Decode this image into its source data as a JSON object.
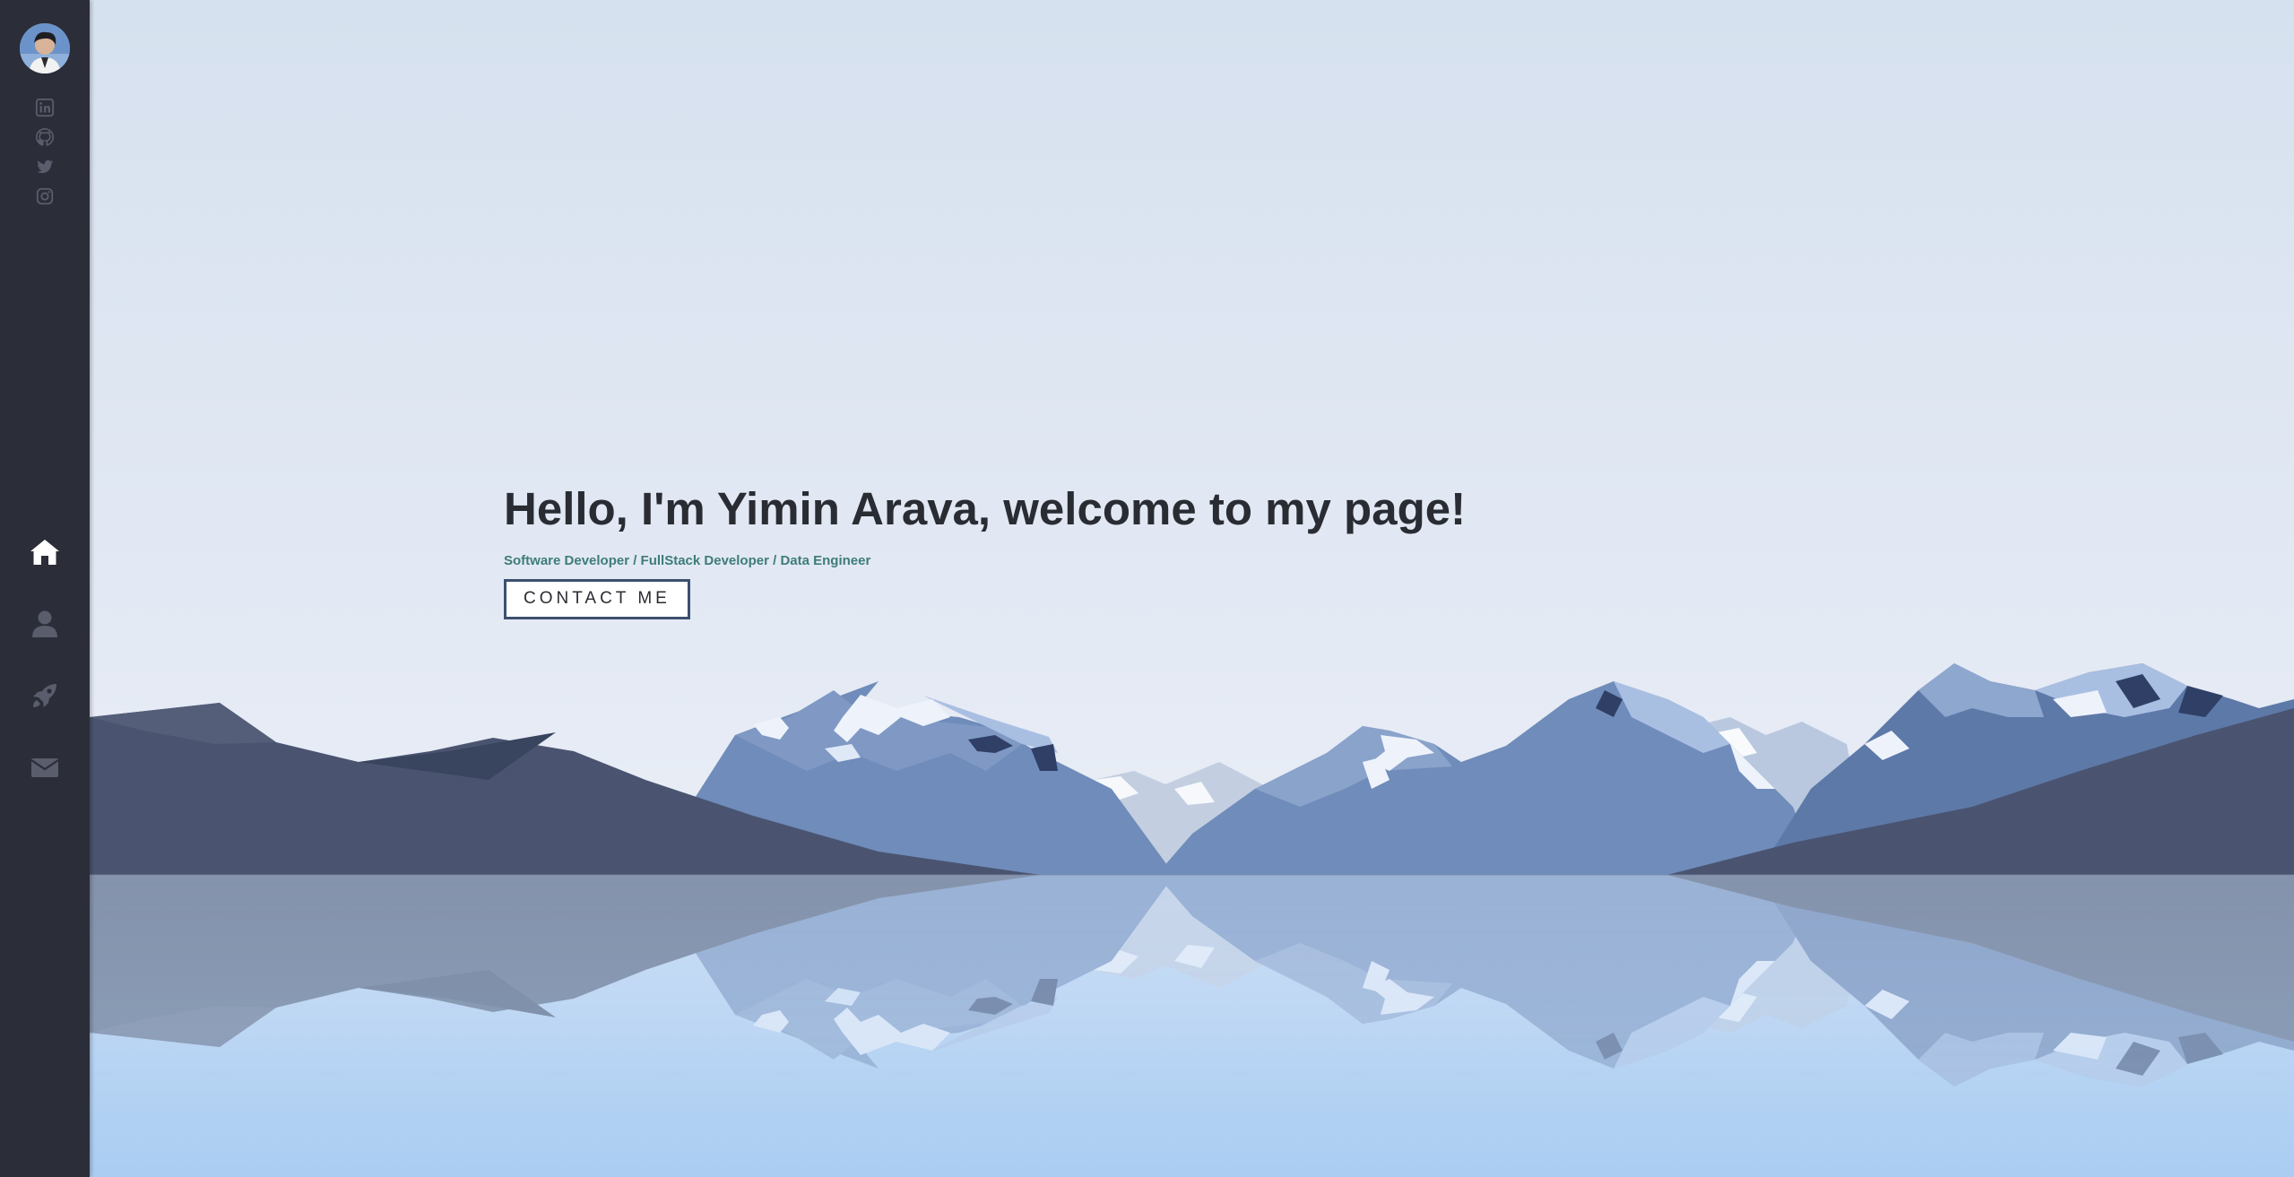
{
  "profile": {
    "avatar_icon": "avatar-photo"
  },
  "social_links": [
    {
      "name": "linkedin",
      "icon": "linkedin-icon"
    },
    {
      "name": "github",
      "icon": "github-icon"
    },
    {
      "name": "twitter",
      "icon": "twitter-icon"
    },
    {
      "name": "instagram",
      "icon": "instagram-icon"
    }
  ],
  "nav": [
    {
      "name": "home",
      "icon": "home-icon",
      "active": true
    },
    {
      "name": "about",
      "icon": "user-icon",
      "active": false
    },
    {
      "name": "projects",
      "icon": "rocket-icon",
      "active": false
    },
    {
      "name": "contact",
      "icon": "envelope-icon",
      "active": false
    }
  ],
  "hero": {
    "title": "Hello, I'm Yimin Arava, welcome to my page!",
    "subtitle": "Software Developer / FullStack Developer / Data Engineer",
    "cta_label": "CONTACT ME"
  },
  "colors": {
    "sidebar_bg": "#2b2d38",
    "icon_muted": "#5a5d6b",
    "icon_active": "#ffffff",
    "title": "#2a2c33",
    "subtitle": "#3e7c7a",
    "button_border": "#3c4f6e"
  }
}
